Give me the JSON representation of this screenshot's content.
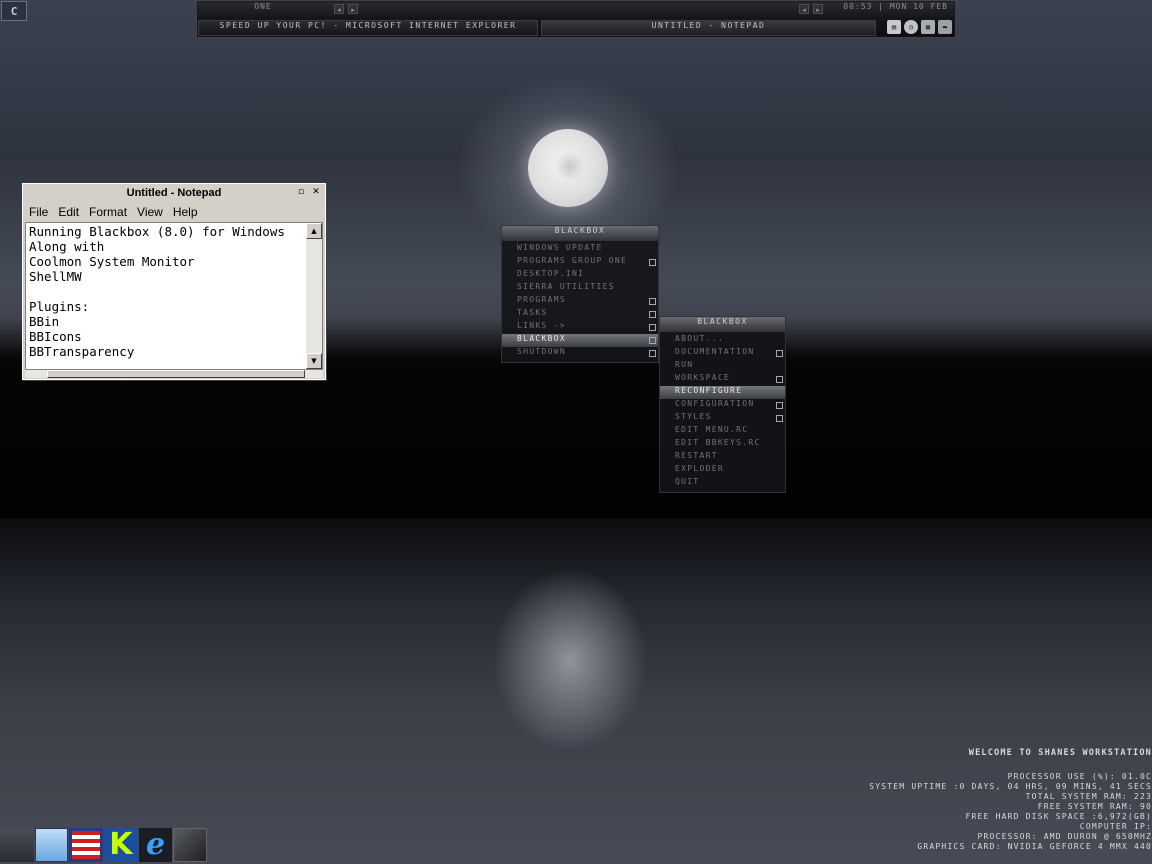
{
  "corner_button": {
    "icon": "blackbox-menu-icon",
    "glyph": "C"
  },
  "toolbar": {
    "workspace": "ONE",
    "clock": "00:53 | MON 10 FEB",
    "tasks": [
      {
        "label": "SPEED UP YOUR PC! - MICROSOFT INTERNET EXPLORER",
        "active": false
      },
      {
        "label": "UNTITLED - NOTEPAD",
        "active": true
      }
    ],
    "tray_icons": [
      "coolmon-icon",
      "clock-icon",
      "network-icon",
      "drive-icon"
    ]
  },
  "notepad": {
    "title": "Untitled - Notepad",
    "menu": [
      "File",
      "Edit",
      "Format",
      "View",
      "Help"
    ],
    "content": "Running Blackbox (8.0) for Windows\nAlong with\nCoolmon System Monitor\nShellMW\n\nPlugins:\nBBin\nBBIcons\nBBTransparency"
  },
  "blackbox_menu": {
    "title": "BLACKBOX",
    "items": [
      {
        "label": "WINDOWS UPDATE",
        "submenu": false,
        "active": false
      },
      {
        "label": "PROGRAMS GROUP ONE",
        "submenu": true,
        "active": false
      },
      {
        "label": "DESKTOP.INI",
        "submenu": false,
        "active": false
      },
      {
        "label": "SIERRA UTILITIES",
        "submenu": false,
        "active": false
      },
      {
        "label": "PROGRAMS",
        "submenu": true,
        "active": false
      },
      {
        "label": "TASKS",
        "submenu": true,
        "active": false
      },
      {
        "label": "LINKS ->",
        "submenu": true,
        "active": false
      },
      {
        "label": "BLACKBOX",
        "submenu": true,
        "active": true
      },
      {
        "label": "SHUTDOWN",
        "submenu": true,
        "active": false
      }
    ]
  },
  "blackbox_submenu": {
    "title": "BLACKBOX",
    "items": [
      {
        "label": "ABOUT...",
        "submenu": false,
        "active": false
      },
      {
        "label": "DOCUMENTATION",
        "submenu": true,
        "active": false
      },
      {
        "label": "RUN",
        "submenu": false,
        "active": false
      },
      {
        "label": "WORKSPACE",
        "submenu": true,
        "active": false
      },
      {
        "label": "RECONFIGURE",
        "submenu": false,
        "active": true
      },
      {
        "label": "CONFIGURATION",
        "submenu": true,
        "active": false
      },
      {
        "label": "STYLES",
        "submenu": true,
        "active": false
      },
      {
        "label": "EDIT MENU.RC",
        "submenu": false,
        "active": false
      },
      {
        "label": "EDIT BBKEYS.RC",
        "submenu": false,
        "active": false
      },
      {
        "label": "RESTART",
        "submenu": false,
        "active": false
      },
      {
        "label": "EXPLODER",
        "submenu": false,
        "active": false
      },
      {
        "label": "QUIT",
        "submenu": false,
        "active": false
      }
    ]
  },
  "dock_icons": [
    "desktop-icon",
    "notepad-icon",
    "floppy-disk-icon",
    "k-app-icon",
    "internet-explorer-icon",
    "box-icon"
  ],
  "sysinfo": {
    "welcome": "WELCOME TO SHANES WORKSTATION",
    "lines": [
      "PROCESSOR USE (%): 01.0C",
      "SYSTEM UPTIME :0 DAYS, 04 HRS, 09 MINS, 41 SECS",
      "TOTAL SYSTEM RAM: 223",
      "FREE SYSTEM RAM: 90",
      "FREE HARD DISK SPACE :6,972(GB)",
      "COMPUTER IP:",
      "PROCESSOR: AMD DURON @ 650MHZ",
      "GRAPHICS CARD: NVIDIA GEFORCE 4 MMX 440"
    ]
  }
}
